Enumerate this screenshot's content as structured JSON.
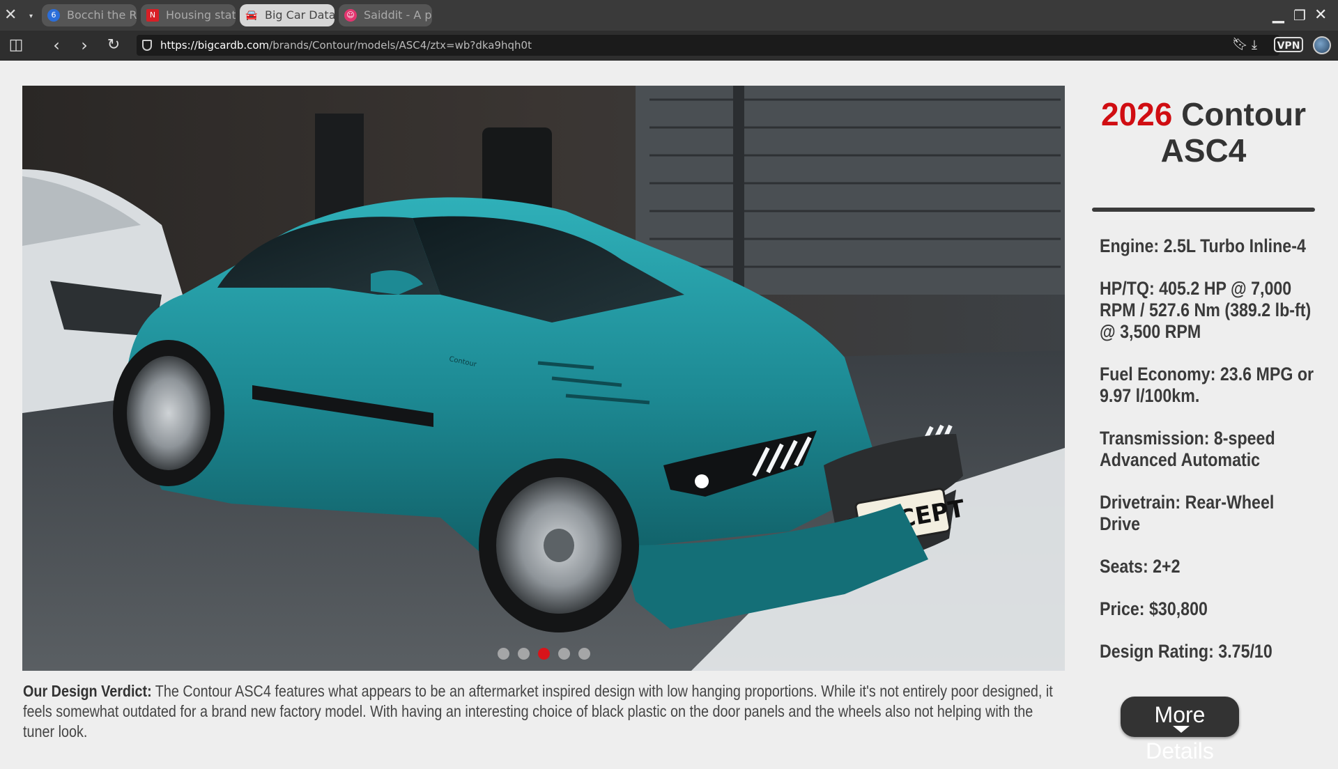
{
  "browser": {
    "tabs": [
      {
        "label": "Bocchi the R",
        "icon": "number-6-icon",
        "icon_color": "#2b6ed9",
        "active": false
      },
      {
        "label": "Housing stat",
        "icon": "netflix-n-icon",
        "icon_color": "#d81f26",
        "active": false
      },
      {
        "label": "Big Car Data",
        "icon": "car-icon",
        "icon_color": "#444444",
        "active": true
      },
      {
        "label": "Saiddit - A p",
        "icon": "alien-icon",
        "icon_color": "#e2356f",
        "active": false
      }
    ],
    "url_host": "https://bigcardb.com",
    "url_path": "/brands/Contour/models/ASC4/ztx=wb?dka9hqh0t",
    "vpn_label": "VPN"
  },
  "car": {
    "year": "2026",
    "name": "Contour ASC4",
    "title_line1": "Contour",
    "title_line2": "ASC4",
    "plate": "CONCEPT",
    "badge": "Contour",
    "image_dot_count": 5,
    "image_active_dot": 3,
    "body_color": "#1d8a94"
  },
  "specs": [
    "Engine: 2.5L Turbo Inline-4",
    "HP/TQ: 405.2 HP @ 7,000 RPM / 527.6 Nm (389.2 lb-ft) @ 3,500 RPM",
    "Fuel Economy: 23.6 MPG or 9.97 l/100km.",
    "Transmission: 8-speed Advanced Automatic",
    "Drivetrain: Rear-Wheel Drive",
    "Seats: 2+2",
    "Price: $30,800",
    "Design Rating: 3.75/10"
  ],
  "verdict": {
    "label": "Our Design Verdict:",
    "text": "The Contour ASC4 features what appears to be an aftermarket inspired design with low hanging proportions. While it's not entirely poor designed, it feels somewhat outdated for a brand new factory model. With having an interesting choice of black plastic on the door panels and the wheels also not helping with the tuner look."
  },
  "more_details_label": "More Details",
  "colors": {
    "accent_red": "#d00d12",
    "text_dark": "#3a3a3a",
    "page_bg": "#eeeeee"
  }
}
